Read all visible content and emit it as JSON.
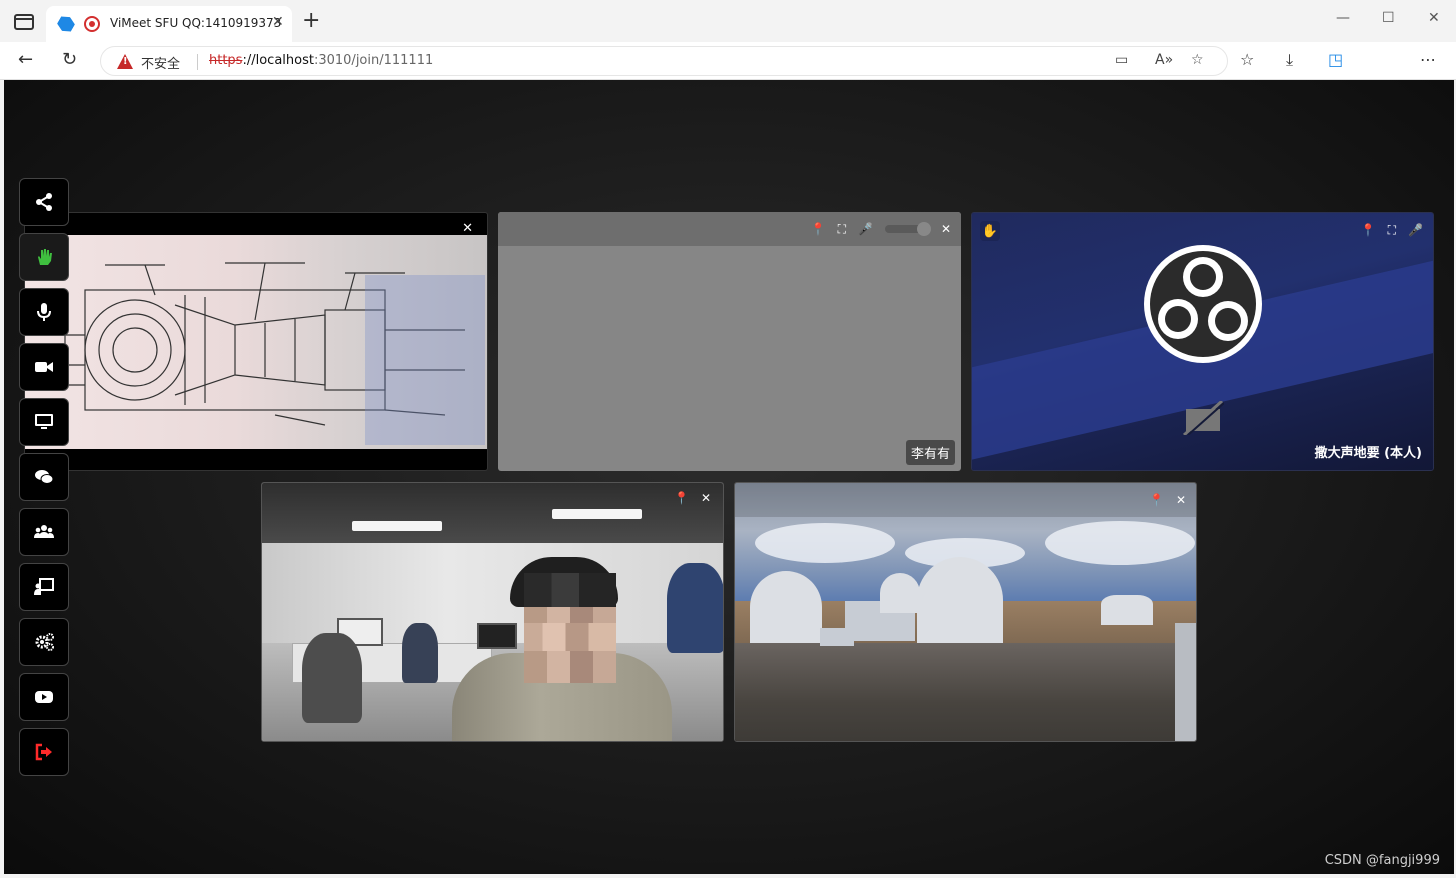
{
  "browser": {
    "tab_title": "ViMeet SFU QQ:1410919373",
    "insecure_label": "不安全",
    "url_proto": "https",
    "url_host": "://localhost",
    "url_rest": ":3010/join/111111"
  },
  "sidebar": {
    "items": [
      {
        "name": "share",
        "icon": "share-icon"
      },
      {
        "name": "raise-hand",
        "icon": "hand-icon"
      },
      {
        "name": "microphone",
        "icon": "microphone-icon"
      },
      {
        "name": "camera",
        "icon": "video-camera-icon"
      },
      {
        "name": "screen-share",
        "icon": "desktop-icon"
      },
      {
        "name": "chat",
        "icon": "chat-icon"
      },
      {
        "name": "participants",
        "icon": "users-icon"
      },
      {
        "name": "whiteboard",
        "icon": "presentation-icon"
      },
      {
        "name": "settings",
        "icon": "gears-icon"
      },
      {
        "name": "recording",
        "icon": "youtube-icon"
      },
      {
        "name": "leave",
        "icon": "exit-icon"
      }
    ]
  },
  "tiles": {
    "tile2_name": "李有有",
    "tile3_name": "撒大声地要 (本人)"
  },
  "colors": {
    "hand_active": "#3fbf3f",
    "leave_red": "#ff2a2a",
    "obs_background": "#1b2555"
  },
  "watermark": "CSDN @fangji999"
}
